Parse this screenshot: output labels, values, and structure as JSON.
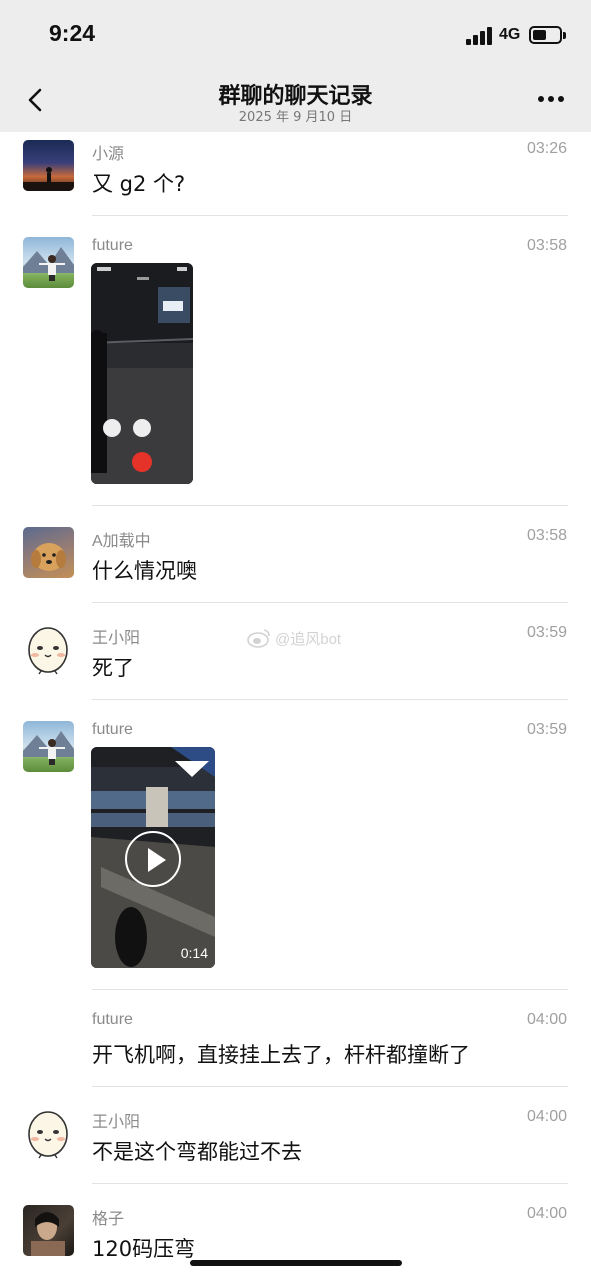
{
  "status_bar": {
    "time": "9:24",
    "network": "4G",
    "battery_level": 0.5
  },
  "header": {
    "title": "群聊的聊天记录",
    "subtitle": "2025 年 9 月10 日",
    "back_icon": "chevron-left-icon",
    "more_icon": "ellipsis-icon"
  },
  "messages": [
    {
      "sender": "小源",
      "time": "03:26",
      "type": "text",
      "text": "又 g2 个?"
    },
    {
      "sender": "future",
      "time": "03:58",
      "type": "image"
    },
    {
      "sender": "A加载中",
      "time": "03:58",
      "type": "text",
      "text": "什么情况噢"
    },
    {
      "sender": "王小阳",
      "time": "03:59",
      "type": "text",
      "text": "死了"
    },
    {
      "sender": "future",
      "time": "03:59",
      "type": "video",
      "duration": "0:14"
    },
    {
      "sender": "future",
      "time": "04:00",
      "type": "text",
      "text": "开飞机啊，直接挂上去了，杆杆都撞断了"
    },
    {
      "sender": "王小阳",
      "time": "04:00",
      "type": "text",
      "text": "不是这个弯都能过不去"
    },
    {
      "sender": "格子",
      "time": "04:00",
      "type": "text",
      "text": "120码压弯"
    }
  ],
  "watermark": "@追风bot"
}
